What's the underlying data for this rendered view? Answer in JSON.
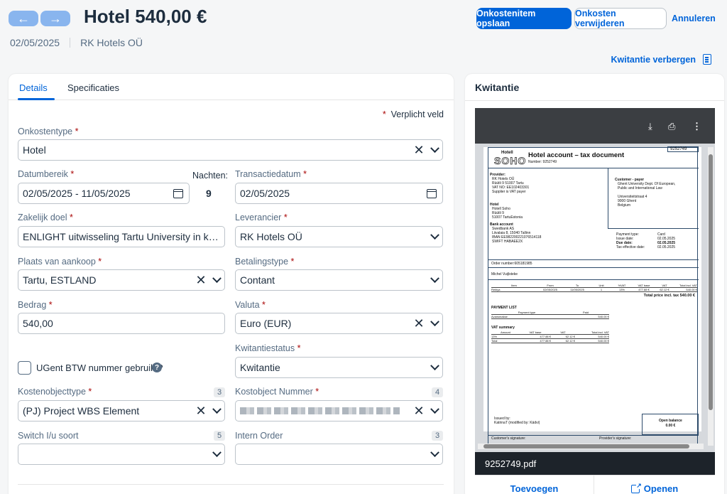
{
  "header": {
    "back_icon": "arrow-left-icon",
    "forward_icon": "arrow-right-icon",
    "title": "Hotel 540,00 €",
    "date": "02/05/2025",
    "vendor": "RK Hotels OÜ",
    "save_label": "Onkostenitem opslaan",
    "delete_label": "Onkosten verwijderen",
    "cancel_label": "Annuleren",
    "hide_receipt_label": "Kwitantie verbergen",
    "accent": "#0064d9"
  },
  "tabs": [
    {
      "label": "Details",
      "active": true
    },
    {
      "label": "Specificaties",
      "active": false
    }
  ],
  "form": {
    "required_note": "Verplicht veld",
    "expense_type": {
      "label": "Onkostentype",
      "value": "Hotel"
    },
    "date_range": {
      "label": "Datumbereik",
      "value": "02/05/2025 - 11/05/2025"
    },
    "nights": {
      "label": "Nachten:",
      "value": "9"
    },
    "transaction_date": {
      "label": "Transactiedatum",
      "value": "02/05/2025"
    },
    "business_purpose": {
      "label": "Zakelijk doel",
      "value": "ENLIGHT uitwisseling Tartu University in kade..."
    },
    "supplier": {
      "label": "Leverancier",
      "value": "RK Hotels OÜ"
    },
    "place_of_purchase": {
      "label": "Plaats van aankoop",
      "value": "Tartu, ESTLAND"
    },
    "payment_type": {
      "label": "Betalingstype",
      "value": "Contant"
    },
    "amount": {
      "label": "Bedrag",
      "value": "540,00"
    },
    "currency": {
      "label": "Valuta",
      "value": "Euro (EUR)"
    },
    "receipt_status": {
      "label": "Kwitantiestatus",
      "value": "Kwitantie"
    },
    "vat_checkbox": {
      "label": "UGent BTW nummer gebruikt?",
      "checked": false
    },
    "cost_object_type": {
      "label": "Kostenobjecttype",
      "count": "3",
      "value": "(PJ) Project WBS Element"
    },
    "cost_object_number": {
      "label": "Kostobject Nummer",
      "count": "4",
      "value": ""
    },
    "switch_type": {
      "label": "Switch I/u soort",
      "count": "5",
      "value": ""
    },
    "internal_order": {
      "label": "Intern Order",
      "count": "3",
      "value": ""
    }
  },
  "receipt": {
    "title": "Kwitantie",
    "filename": "9252749.pdf",
    "add_label": "Toevoegen",
    "open_label": "Openen",
    "doc": {
      "brand_top": "Hotell",
      "brand": "SOHO",
      "heading": "Hotel account – tax document",
      "number_label": "Number: 9252749",
      "number": "9252749",
      "provider_label": "Provider:",
      "provider_lines": [
        "RK Hotels OÜ",
        "Rüütli 9 51007 Tartu",
        "VAT NO:    EE102403301",
        "Supplier is VAT payer"
      ],
      "hotel_label": "Hotel",
      "hotel_lines": [
        "Hotell Soho",
        "Rüütli 9",
        "51007 TartuEstonia"
      ],
      "bank_label": "Bank account",
      "bank_lines": [
        "Swedbank AS",
        "Liivalaia 8, 15040 Tallinn",
        "IBAN        EE982200221076514118",
        "SWIFT      HABAEE2X"
      ],
      "customer_label": "Customer - payer",
      "customer_lines": [
        "Ghent University Dept. Of European,",
        "Public and International Law",
        "",
        "Universiteitstraat 4",
        "9000 Ghent",
        "Belgium"
      ],
      "payment_lines": [
        [
          "Payment type:",
          "Card"
        ],
        [
          "Issue date:",
          "02.05.2025"
        ],
        [
          "Due date:",
          "02.05.2025"
        ],
        [
          "Tax effective date:",
          "02.05.2025"
        ]
      ],
      "order_number": "Order number:605181985",
      "guest": "Michel Vuijlsteke",
      "item_headers": [
        "Item",
        "From",
        "To",
        "Unit",
        "%VAT",
        "VAT base",
        "VAT",
        "Total incl. VAT"
      ],
      "item_row": [
        "Rebiya",
        "02/05/2025",
        "11/05/2025",
        "1",
        "13%",
        "477.88 €",
        "62.12 €",
        "540.00 €"
      ],
      "total_line": "Total price incl. tax 540.00 €",
      "payment_list_label": "PAYMENT LIST",
      "payment_list_headers": [
        "Payment type",
        "Paid"
      ],
      "payment_list_row": [
        "Avansmakse",
        "540.00 €"
      ],
      "vat_summary_label": "VAT summary",
      "vat_headers": [
        "Amount",
        "VAT base",
        "VAT",
        "Total incl. VAT"
      ],
      "vat_rows": [
        [
          "13%",
          "477.88 €",
          "62.12 €",
          "540.00 €"
        ],
        [
          "Total",
          "477.88 €",
          "62.12 €",
          "540.00 €"
        ]
      ],
      "issued_by_label": "Issued by:",
      "issued_by": "KatrinaT (modified by: Kädvi)",
      "open_balance_label": "Open balance",
      "open_balance": "0.00 €",
      "customer_signature": "Customer's signature:",
      "provider_signature": "Provider's signature:"
    }
  }
}
